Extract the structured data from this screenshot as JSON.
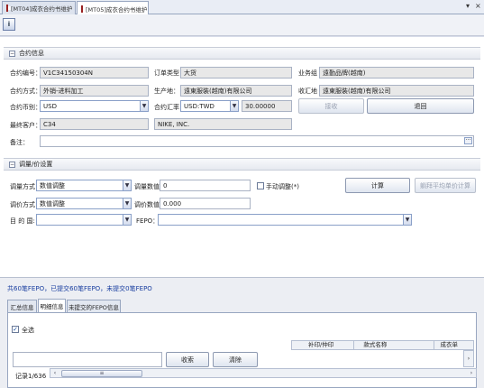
{
  "tabs": [
    {
      "label": "[MT04]成衣合约书维护"
    },
    {
      "label": "[MT05]成衣合约书维护"
    }
  ],
  "window_controls": {
    "dropdown": "▾",
    "close": "×"
  },
  "toolbar": {
    "tool_label": "i"
  },
  "contract_info": {
    "title": "合约信息",
    "collapse_symbol": "−",
    "contract_no_label": "合约编号：",
    "contract_no": "V1C34150304N",
    "contract_method_label": "合约方式：",
    "contract_method": "外销-进料加工",
    "currency_label": "合约币别：",
    "currency": "USD",
    "final_customer_label": "最终客户：",
    "final_customer_code": "C34",
    "final_customer_name": "NIKE, INC.",
    "remark_label": "备注：",
    "remark": "",
    "order_type_label": "订单类型",
    "order_type": "大货",
    "production_label": "生产地：",
    "production": "遠東服裝(越南)有限公司",
    "exchange_rate_label": "合约汇率",
    "exchange_rate_currency": "USD:TWD",
    "exchange_rate": "30.00000",
    "business_group_label": "业务组",
    "business_group": "遠勤品牌(越南)",
    "receiving_label": "收汇地",
    "receiving": "遠東服裝(越南)有限公司",
    "receive_button": "接收",
    "return_button": "退回"
  },
  "adjust": {
    "title": "调量/价设置",
    "collapse_symbol": "−",
    "qty_method_label": "调量方式",
    "qty_method": "数值调整",
    "qty_value_label": "调量数值",
    "qty_value": "0",
    "manual_adjust_label": "手动调整(*)",
    "price_method_label": "调价方式",
    "price_method": "数值调整",
    "price_value_label": "调价数值",
    "price_value": "0.000",
    "destination_label": "目 的 国:",
    "destination": "",
    "fepo_label": "FEPO：",
    "fepo": "",
    "calc_button": "计算",
    "avg_price_button": "躺拜平均单价计算"
  },
  "summary": {
    "status_text": "共60笔FEPO，已提交60笔FEPO，未提交0笔FEPO"
  },
  "inner_tabs": [
    {
      "label": "汇总信息"
    },
    {
      "label": "明细信息"
    },
    {
      "label": "未提交的FEPO信息"
    }
  ],
  "detail": {
    "select_all_label": "全选",
    "check_mark": "✓",
    "columns": [
      "补印/仲印",
      "款式名称",
      "成衣单"
    ],
    "search_button": "收索",
    "clear_button": "清除",
    "record_label": "记录1/636",
    "scroll_grip": "≡",
    "arrow_left": "‹",
    "arrow_right": "›"
  },
  "colors": {
    "accent_blue": "#1a3fa0",
    "panel_bg": "#eceef3",
    "field_readonly": "#e8e8e8"
  }
}
